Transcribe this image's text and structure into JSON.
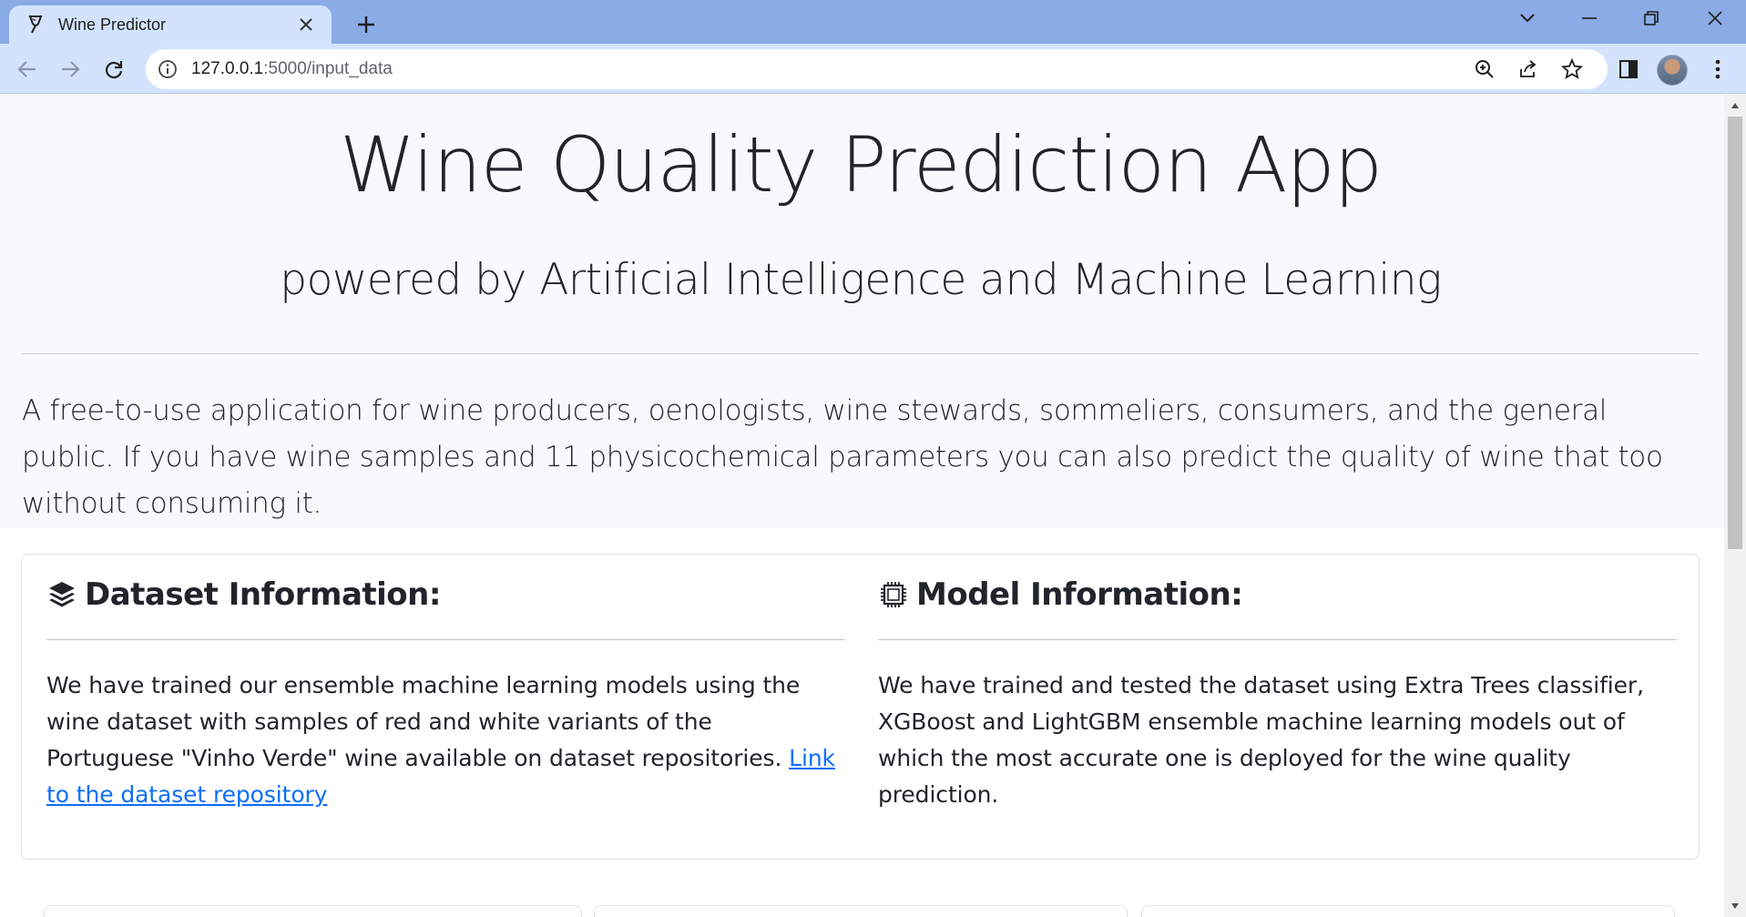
{
  "browser": {
    "tab_title": "Wine Predictor",
    "url_host": "127.0.0.1",
    "url_path": ":5000/input_data"
  },
  "page": {
    "title": "Wine Quality Prediction App",
    "subtitle": "powered by Artificial Intelligence and Machine Learning",
    "lead": "A free-to-use application for wine producers, oenologists, wine stewards, sommeliers, consumers, and the general public. If you have wine samples and 11 physicochemical parameters you can also predict the quality of wine that too without consuming it."
  },
  "dataset_info": {
    "heading": "Dataset Information:",
    "body": "We have trained our ensemble machine learning models using the wine dataset with samples of red and white variants of the Portuguese \"Vinho Verde\" wine available on dataset repositories. ",
    "link_text": "Link to the dataset repository"
  },
  "model_info": {
    "heading": "Model Information:",
    "body": "We have trained and tested the dataset using Extra Trees classifier, XGBoost and LightGBM ensemble machine learning models out of which the most accurate one is deployed for the wine quality prediction."
  },
  "colors": {
    "tabbar": "#8aabe6",
    "toolbar": "#d3e3fd",
    "jumbotron": "#f8f9fa",
    "link": "#0d6efd",
    "text": "#212529"
  }
}
